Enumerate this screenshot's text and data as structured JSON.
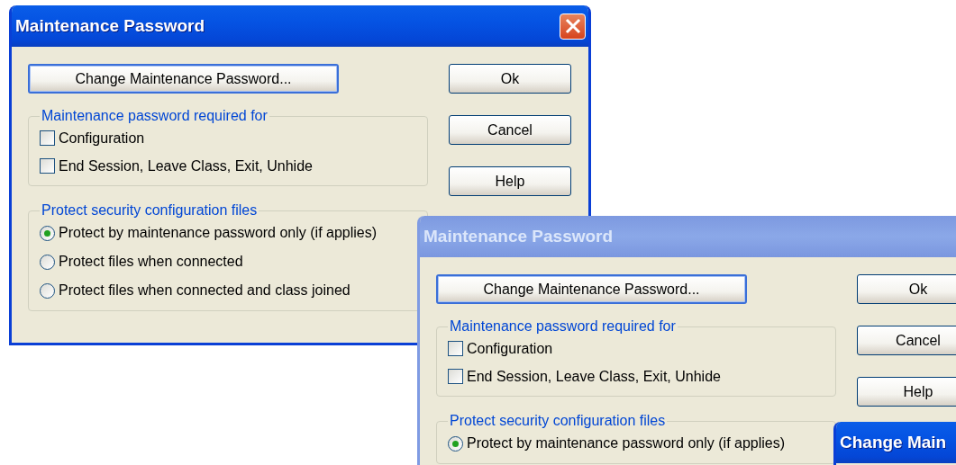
{
  "windows": [
    {
      "title": "Maintenance Password",
      "active": true,
      "close_button": true,
      "change_button": "Change Maintenance Password...",
      "buttons": [
        "Ok",
        "Cancel",
        "Help"
      ],
      "groups": [
        {
          "label": "Maintenance password required for",
          "items": [
            {
              "kind": "checkbox",
              "label": "Configuration",
              "checked": false
            },
            {
              "kind": "checkbox",
              "label": "End Session, Leave Class, Exit, Unhide",
              "checked": false
            }
          ]
        },
        {
          "label": "Protect security configuration files",
          "items": [
            {
              "kind": "radio",
              "label": "Protect by maintenance password only (if applies)",
              "selected": true
            },
            {
              "kind": "radio",
              "label": "Protect files when connected",
              "selected": false
            },
            {
              "kind": "radio",
              "label": "Protect files when connected and class joined",
              "selected": false
            }
          ]
        }
      ]
    },
    {
      "title": "Maintenance Password",
      "active": false,
      "close_button": false,
      "change_button": "Change Maintenance Password...",
      "buttons": [
        "Ok",
        "Cancel",
        "Help"
      ],
      "groups": [
        {
          "label": "Maintenance password required for",
          "items": [
            {
              "kind": "checkbox",
              "label": "Configuration",
              "checked": false
            },
            {
              "kind": "checkbox",
              "label": "End Session, Leave Class, Exit, Unhide",
              "checked": false
            }
          ]
        },
        {
          "label": "Protect security configuration files",
          "items": [
            {
              "kind": "radio",
              "label": "Protect by maintenance password only (if applies)",
              "selected": true
            }
          ]
        }
      ]
    },
    {
      "title": "Change Main",
      "active": true,
      "close_button": false
    }
  ]
}
